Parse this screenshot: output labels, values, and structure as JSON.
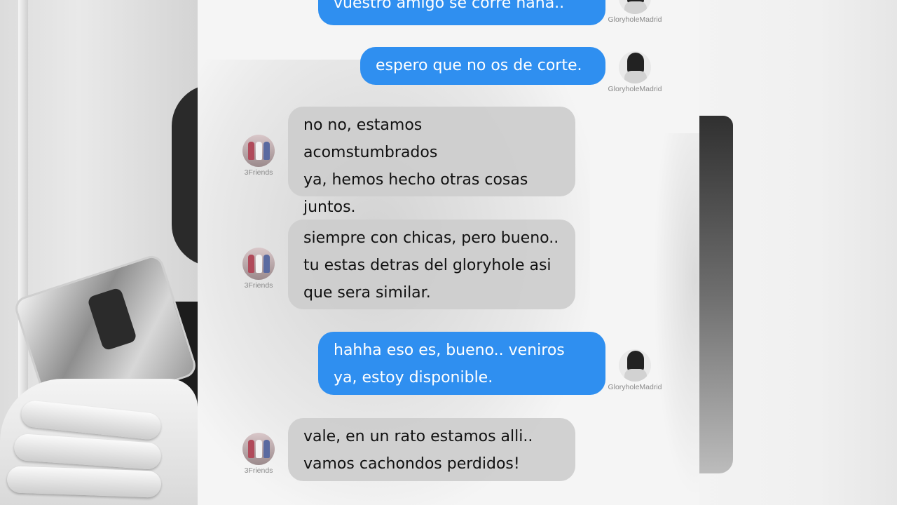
{
  "chat": {
    "messages": [
      {
        "direction": "outgoing",
        "text": "vuestro amigo se corre haha..",
        "sender": "GloryholeMadrid"
      },
      {
        "direction": "outgoing",
        "text": "espero que no os de corte.",
        "sender": "GloryholeMadrid"
      },
      {
        "direction": "incoming",
        "text": "no no, estamos acomstumbrados\nya, hemos hecho otras cosas\njuntos.",
        "sender": "3Friends"
      },
      {
        "direction": "incoming",
        "text": "siempre con chicas, pero bueno..\ntu estas detras del gloryhole asi\nque sera similar.",
        "sender": "3Friends"
      },
      {
        "direction": "outgoing",
        "text": "hahha eso es, bueno.. veniros\nya, estoy disponible.",
        "sender": "GloryholeMadrid"
      },
      {
        "direction": "incoming",
        "text": "vale, en un rato estamos alli..\nvamos cachondos perdidos!",
        "sender": "3Friends"
      }
    ]
  },
  "colors": {
    "outgoing_bubble": "#2f8ff0",
    "incoming_bubble": "#cdcdcd",
    "panel_bg": "#f5f5f5"
  },
  "icons": {
    "outgoing_avatar": "masked-person-avatar",
    "incoming_avatar": "group-of-three-avatar"
  }
}
